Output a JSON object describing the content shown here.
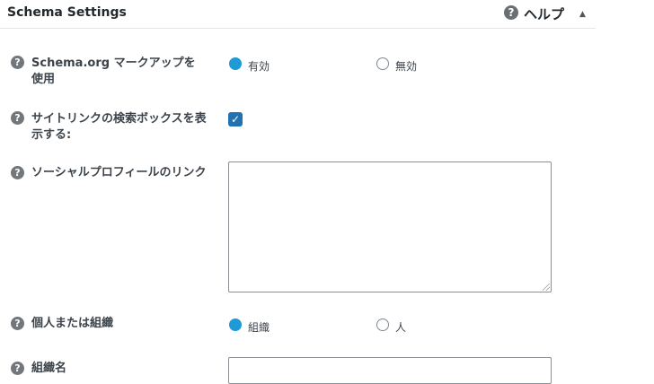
{
  "header": {
    "title": "Schema Settings",
    "help_label": "ヘルプ",
    "help_icon": "question-circle-icon",
    "toggle_icon": "triangle-up-icon"
  },
  "rows": {
    "schema_markup": {
      "label": "Schema.org マークアップを使用",
      "options": [
        {
          "label": "有効",
          "checked": true
        },
        {
          "label": "無効",
          "checked": false
        }
      ]
    },
    "sitelinks": {
      "label": "サイトリンクの検索ボックスを表示する:",
      "checked": true
    },
    "social_profiles": {
      "label": "ソーシャルプロフィールのリンク",
      "value": ""
    },
    "person_or_org": {
      "label": "個人または組織",
      "options": [
        {
          "label": "組織",
          "checked": true
        },
        {
          "label": "人",
          "checked": false
        }
      ]
    },
    "org_name": {
      "label": "組織名",
      "value": ""
    }
  },
  "colors": {
    "accent": "#1e9ad6",
    "checkbox": "#2271b1"
  }
}
